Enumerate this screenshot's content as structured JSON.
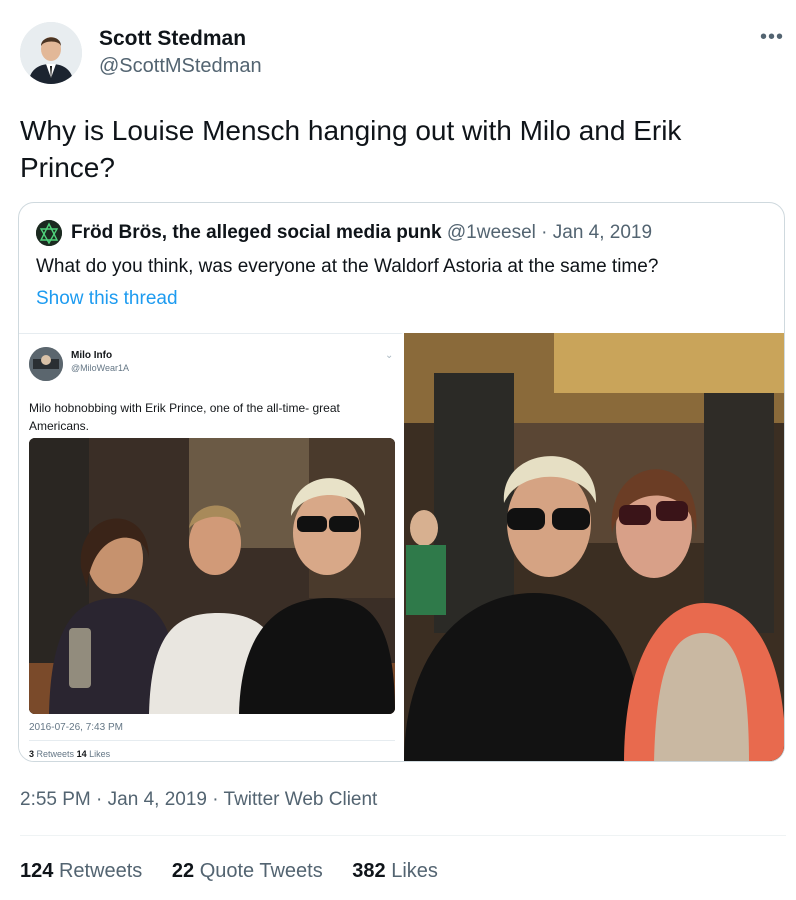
{
  "author": {
    "name": "Scott Stedman",
    "handle": "@ScottMStedman"
  },
  "tweet": {
    "text": "Why is Louise Mensch hanging out with Milo and Erik Prince?"
  },
  "quoted": {
    "name": "Fröd Brös, the alleged social media punk",
    "handle": "@1weesel",
    "separator": "·",
    "date": "Jan 4, 2019",
    "text": "What do you think, was everyone at the Waldorf Astoria at the same time?",
    "show_thread": "Show this thread",
    "screenshot": {
      "name": "Milo Info",
      "handle": "@MiloWear1A",
      "text": "Milo hobnobbing with Erik Prince, one of the all-time- great Americans.",
      "timestamp": "2016-07-26, 7:43 PM",
      "retweets_count": "3",
      "retweets_label": "Retweets",
      "likes_count": "14",
      "likes_label": "Likes"
    }
  },
  "meta": {
    "time": "2:55 PM",
    "separator": "·",
    "date": "Jan 4, 2019",
    "client": "Twitter Web Client"
  },
  "stats": {
    "retweets": {
      "count": "124",
      "label": "Retweets"
    },
    "quotes": {
      "count": "22",
      "label": "Quote Tweets"
    },
    "likes": {
      "count": "382",
      "label": "Likes"
    }
  },
  "icons": {
    "more": "more-icon",
    "avatar": "avatar",
    "chevron": "chevron-down-icon"
  },
  "colors": {
    "link": "#1d9bf0",
    "secondary": "#536471",
    "border": "#cfd9de"
  }
}
